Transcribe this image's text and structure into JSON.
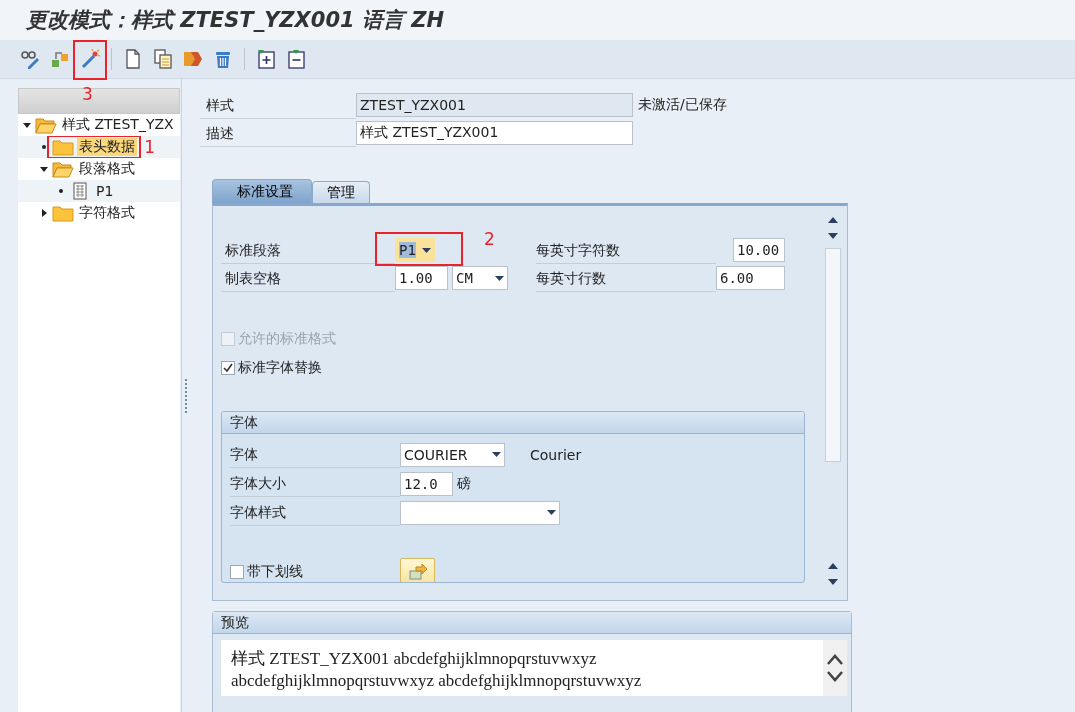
{
  "window": {
    "title": "更改模式：样式 ZTEST_YZX001 语言 ZH"
  },
  "toolbar": [
    {
      "kind": "display"
    },
    {
      "kind": "toggle"
    },
    {
      "kind": "activate",
      "annotation": "3"
    },
    {
      "kind": "separator"
    },
    {
      "kind": "new"
    },
    {
      "kind": "copy"
    },
    {
      "kind": "rename"
    },
    {
      "kind": "delete"
    },
    {
      "kind": "separator"
    },
    {
      "kind": "expand"
    },
    {
      "kind": "collapse"
    }
  ],
  "tree": [
    {
      "label": "样式 ZTEST_YZX",
      "kind": "folder",
      "expanded": true,
      "selected": false,
      "children": [
        {
          "label": "表头数据",
          "kind": "folder",
          "selected": true,
          "annotation": "1"
        },
        {
          "label": "段落格式",
          "kind": "folder",
          "expanded": true,
          "selected": false,
          "children": [
            {
              "label": "P1",
              "kind": "document",
              "selected": false
            }
          ]
        },
        {
          "label": "字符格式",
          "kind": "folder",
          "expanded": false,
          "selected": false
        }
      ]
    }
  ],
  "header_fields": [
    {
      "label": "样式",
      "value": "ZTEST_YZX001",
      "readonly": true,
      "status": "未激活/已保存"
    },
    {
      "label": "描述",
      "value": "样式 ZTEST_YZX001",
      "readonly": false
    }
  ],
  "tabs": [
    {
      "label": "标准设置",
      "selected": true
    },
    {
      "label": "管理",
      "selected": false
    }
  ],
  "settings_left": [
    {
      "label": "标准段落",
      "kind": "dropdown",
      "value": "P1",
      "focused": true,
      "annotation": "2"
    },
    {
      "label": "制表空格",
      "kind": "number-unit",
      "value": "1.00",
      "unit": "CM",
      "focused": false
    }
  ],
  "settings_right": [
    {
      "label": "每英寸字符数",
      "value": "10.00"
    },
    {
      "label": "每英寸行数",
      "value": "6.00"
    }
  ],
  "checkboxes": [
    {
      "label": "允许的标准格式",
      "checked": false,
      "disabled": true
    },
    {
      "label": "标准字体替换",
      "checked": true,
      "disabled": false
    }
  ],
  "font_group": {
    "title": "字体",
    "rows": [
      {
        "label": "字体",
        "kind": "dropdown",
        "value": "COURIER",
        "note": "Courier"
      },
      {
        "label": "字体大小",
        "kind": "number",
        "value": "12.0",
        "unit": "磅"
      },
      {
        "label": "字体样式",
        "kind": "dropdown"
      }
    ],
    "underline": {
      "label": "带下划线",
      "checked": false
    }
  },
  "preview": {
    "title": "预览",
    "lines": [
      "样式 ZTEST_YZX001 abcdefghijklmnopqrstuvwxyz",
      "abcdefghijklmnopqrstuvwxyz abcdefghijklmnopqrstuvwxyz"
    ]
  }
}
